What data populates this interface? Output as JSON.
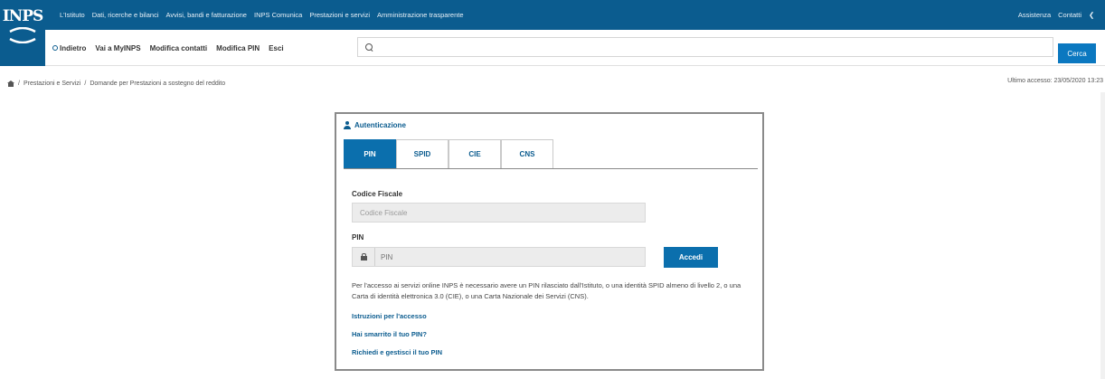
{
  "brand": {
    "logo_text": "INPS"
  },
  "topnav": {
    "items": [
      "L'Istituto",
      "Dati, ricerche e bilanci",
      "Avvisi, bandi e fatturazione",
      "INPS Comunica",
      "Prestazioni e servizi",
      "Amministrazione trasparente"
    ],
    "right": [
      "Assistenza",
      "Contatti"
    ]
  },
  "subnav": {
    "back": "Indietro",
    "links": [
      "Vai a MyINPS",
      "Modifica contatti",
      "Modifica PIN",
      "Esci"
    ]
  },
  "search": {
    "placeholder": "",
    "button": "Cerca"
  },
  "breadcrumb": [
    "Prestazioni e Servizi",
    "Domande per Prestazioni a sostegno del reddito"
  ],
  "last_access": "Ultimo accesso: 23/05/2020 13:23",
  "auth": {
    "title": "Autenticazione",
    "tabs": [
      "PIN",
      "SPID",
      "CIE",
      "CNS"
    ],
    "active_tab": "PIN",
    "cf_label": "Codice Fiscale",
    "cf_placeholder": "Codice Fiscale",
    "pin_label": "PIN",
    "pin_placeholder": "PIN",
    "submit": "Accedi",
    "info": "Per l'accesso ai servizi online INPS è necessario avere un PIN rilasciato dall'Istituto, o una identità SPID almeno di livello 2, o una Carta di identità elettronica 3.0 (CIE), o una Carta Nazionale dei Servizi (CNS).",
    "links": [
      "Istruzioni per l'accesso",
      "Hai smarrito il tuo PIN?",
      "Richiedi e gestisci il tuo PIN"
    ]
  },
  "colors": {
    "brand_blue": "#0b5c8f",
    "button_blue": "#0b6fad"
  }
}
